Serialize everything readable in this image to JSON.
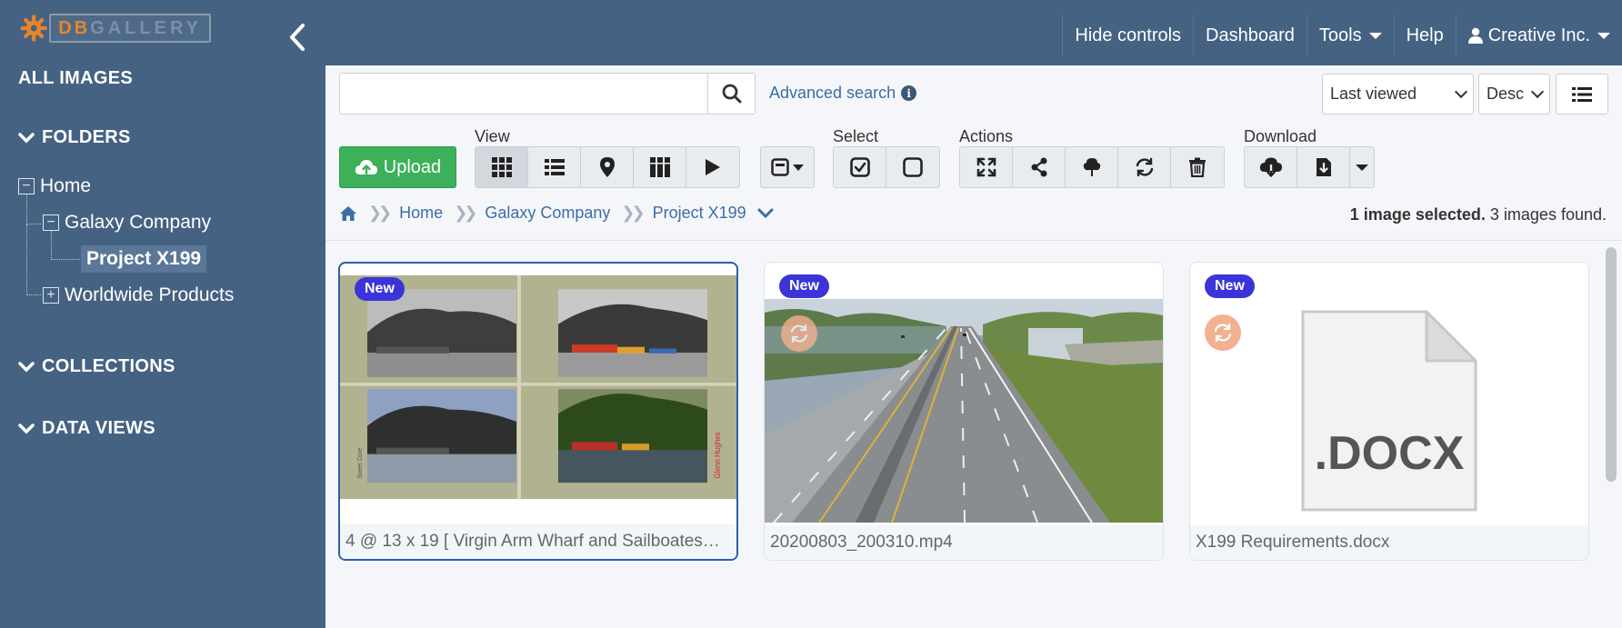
{
  "logo": {
    "part1": "DB",
    "part2": "GALLERY"
  },
  "sidebar": {
    "all_images": "ALL IMAGES",
    "folders": "FOLDERS",
    "tree": {
      "home": "Home",
      "galaxy": "Galaxy Company",
      "project": "Project X199",
      "worldwide": "Worldwide Products"
    },
    "collections": "COLLECTIONS",
    "data_views": "DATA VIEWS"
  },
  "topnav": {
    "hide_controls": "Hide controls",
    "dashboard": "Dashboard",
    "tools": "Tools",
    "help": "Help",
    "account": "Creative Inc."
  },
  "search": {
    "value": "",
    "placeholder": "",
    "advanced": "Advanced search"
  },
  "sort": {
    "field": "Last viewed",
    "order": "Desc"
  },
  "toolbar": {
    "upload": "Upload",
    "view_label": "View",
    "select_label": "Select",
    "actions_label": "Actions",
    "download_label": "Download"
  },
  "breadcrumb": {
    "items": [
      "Home",
      "Galaxy Company",
      "Project X199"
    ]
  },
  "status": {
    "selected": "1 image selected.",
    "found": "3 images found."
  },
  "cards": [
    {
      "badge": "New",
      "title": "4 @ 13 x 19 [ Virgin Arm Wharf and Sailboates…",
      "selected": true
    },
    {
      "badge": "New",
      "title": "20200803_200310.mp4",
      "selected": false
    },
    {
      "badge": "New",
      "title": "X199 Requirements.docx",
      "selected": false,
      "doc_label": ".DOCX"
    }
  ],
  "colors": {
    "sidebar": "#456282",
    "upload": "#3cb15a",
    "badge": "#3b34d9",
    "link": "#3b6ea5"
  }
}
